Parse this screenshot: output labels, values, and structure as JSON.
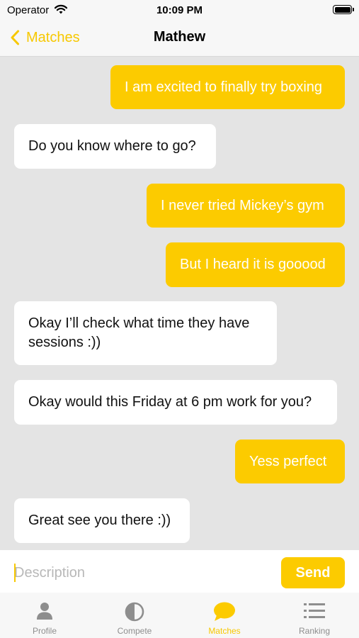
{
  "status_bar": {
    "carrier": "Operator",
    "time": "10:09 PM"
  },
  "nav": {
    "back_label": "Matches",
    "title": "Mathew"
  },
  "messages": [
    {
      "sender": "me",
      "text": "I am excited to finally try boxing"
    },
    {
      "sender": "them",
      "text": "Do you know where to go?"
    },
    {
      "sender": "me",
      "text": "I never tried Mickey’s gym"
    },
    {
      "sender": "me",
      "text": "But I heard it is gooood"
    },
    {
      "sender": "them",
      "text": "Okay I’ll check what time they have sessions :))"
    },
    {
      "sender": "them",
      "text": "Okay would this Friday at 6 pm work for you?"
    },
    {
      "sender": "me",
      "text": "Yess perfect"
    },
    {
      "sender": "them",
      "text": "Great see you there :))"
    }
  ],
  "composer": {
    "placeholder": "Description",
    "value": "",
    "send_label": "Send"
  },
  "tabs": [
    {
      "label": "Profile",
      "icon": "person-icon",
      "active": false
    },
    {
      "label": "Compete",
      "icon": "half-circle-icon",
      "active": false
    },
    {
      "label": "Matches",
      "icon": "chat-bubble-icon",
      "active": true
    },
    {
      "label": "Ranking",
      "icon": "list-icon",
      "active": false
    }
  ],
  "colors": {
    "accent": "#fccb00",
    "chat_background": "#e4e4e4",
    "incoming_bubble": "#ffffff",
    "inactive_tab": "#8e8e8e"
  }
}
